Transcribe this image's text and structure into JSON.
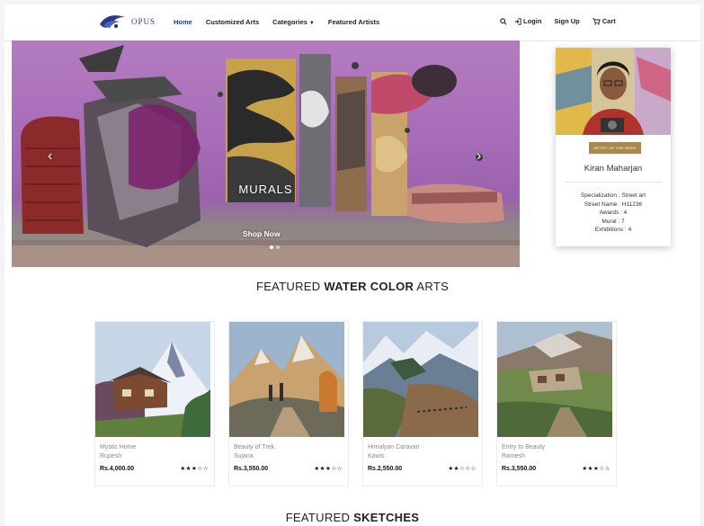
{
  "nav": {
    "logo_text": "OPUS",
    "links": [
      "Home",
      "Customized Arts",
      "Categories",
      "Featured Artists"
    ],
    "login": "Login",
    "signup": "Sign Up",
    "cart": "Cart"
  },
  "hero": {
    "caption": "MURALS",
    "button": "Shop Now",
    "slides": 2,
    "active_slide": 1
  },
  "artist": {
    "badge": "ARTIST OF THE WEEK",
    "name": "Kiran Maharjan",
    "specialization": "Specialization : Street art",
    "street_name": "Street Name : H11236",
    "awards": "Awards : 4",
    "mural": "Mural : 7",
    "exhibitions": "Exhibitions : 4"
  },
  "sections": {
    "watercolor_prefix": "FEATURED ",
    "watercolor_bold": "WATER COLOR",
    "watercolor_suffix": " ARTS",
    "sketches_prefix": "FEATURED ",
    "sketches_bold": "SKETCHES"
  },
  "products": [
    {
      "title": "Mystic Home",
      "artist": "Rupesh",
      "price": "Rs.4,000.00",
      "stars": "★★★☆☆",
      "rating": 3
    },
    {
      "title": "Beauty of Trek",
      "artist": "Sujana",
      "price": "Rs.3,550.00",
      "stars": "★★★☆☆",
      "rating": 3
    },
    {
      "title": "Himalyan Caravan",
      "artist": "Kawis",
      "price": "Rs.2,550.00",
      "stars": "★★☆☆☆",
      "rating": 2
    },
    {
      "title": "Entry to Beauty",
      "artist": "Ramesh",
      "price": "Rs.3,550.00",
      "stars": "★★★☆☆",
      "rating": 3
    }
  ]
}
